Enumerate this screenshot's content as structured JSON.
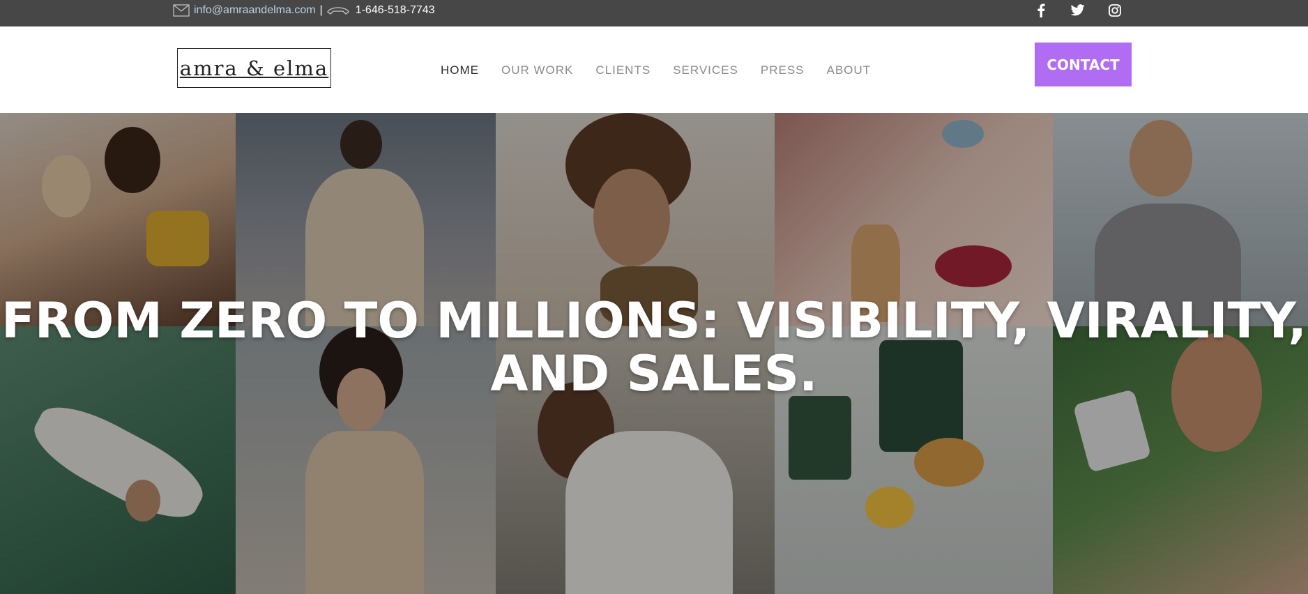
{
  "topbar": {
    "email": "info@amraandelma.com",
    "separator": "|",
    "phone": "1-646-518-7743",
    "email_icon": "envelope-icon",
    "phone_icon": "telephone-icon",
    "social": [
      "facebook-icon",
      "twitter-icon",
      "instagram-icon"
    ]
  },
  "header": {
    "logo": "amra & elma",
    "nav": {
      "home": "HOME",
      "our_work": "OUR WORK",
      "clients": "CLIENTS",
      "services": "SERVICES",
      "press": "PRESS",
      "about": "ABOUT"
    },
    "contact_label": "CONTACT"
  },
  "hero": {
    "headline_line1": "FROM ZERO TO MILLIONS: VISIBILITY, VIRALITY,",
    "headline_line2": "AND SALES."
  },
  "colors": {
    "topbar_bg": "#474747",
    "email_link": "#bcd3e6",
    "nav_active": "#2b2b2b",
    "nav_inactive": "#8a8a8a",
    "contact_button": "#b06cf2"
  }
}
